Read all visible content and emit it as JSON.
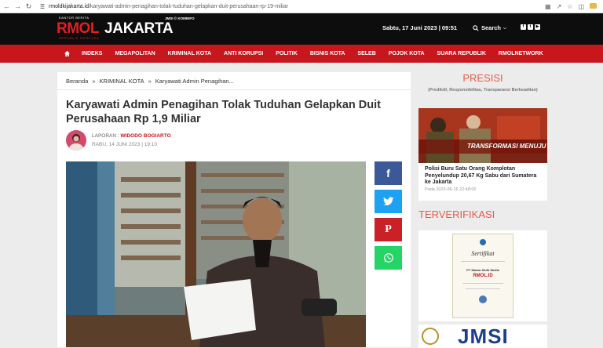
{
  "browser": {
    "url_host": "rmoldkijakarta.id",
    "url_path": "/karyawati-admin-penagihan-tolak-tuduhan-gelapkan-duit-perusahaan-rp-19-miliar"
  },
  "header": {
    "logo_tag": "KANTOR BERITA",
    "logo_rmol": "RMOL",
    "logo_city": "JAKARTA",
    "logo_partner": "JMSI © KOMINFO",
    "logo_sub": "REPUBLIK MERDEKA",
    "date": "Sabtu, 17 Juni 2023 | 09:51",
    "search_label": "Search"
  },
  "nav": {
    "items": [
      "INDEKS",
      "MEGAPOLITAN",
      "KRIMINAL KOTA",
      "ANTI KORUPSI",
      "POLITIK",
      "BISNIS KOTA",
      "SELEB",
      "POJOK KOTA",
      "SUARA REPUBLIK",
      "RMOLNETWORK"
    ]
  },
  "breadcrumb": {
    "home": "Beranda",
    "category": "KRIMINAL KOTA",
    "current": "Karyawati Admin Penagihan..."
  },
  "article": {
    "title": "Karyawati Admin Penagihan Tolak Tuduhan Gelapkan Duit Perusahaan Rp 1,9 Miliar",
    "report_label": "LAPORAN :",
    "author": "WIDODO BOGIARTO",
    "date": "RABU, 14 JUNI 2023 | 19:10"
  },
  "sidebar": {
    "presisi_title": "PRESISI",
    "presisi_sub": "(Prediktif, Responsibilitas, Transparansi Berkeadilan)",
    "news_banner": "TRANSFORMASI MENUJU",
    "news_title": "Polisi Buru Satu Orang Komplotan Penyelundup 20,67 Kg Sabu dari Sumatera ke Jakarta",
    "news_date": "Pada 2023-06-16 22:48:00",
    "verified_title": "TERVERIFIKASI",
    "cert_title": "Sertifikat",
    "cert_company": "PT Mawar Multi Media",
    "cert_brand": "RMOL.ID",
    "jmsi_text": "JMSI"
  }
}
